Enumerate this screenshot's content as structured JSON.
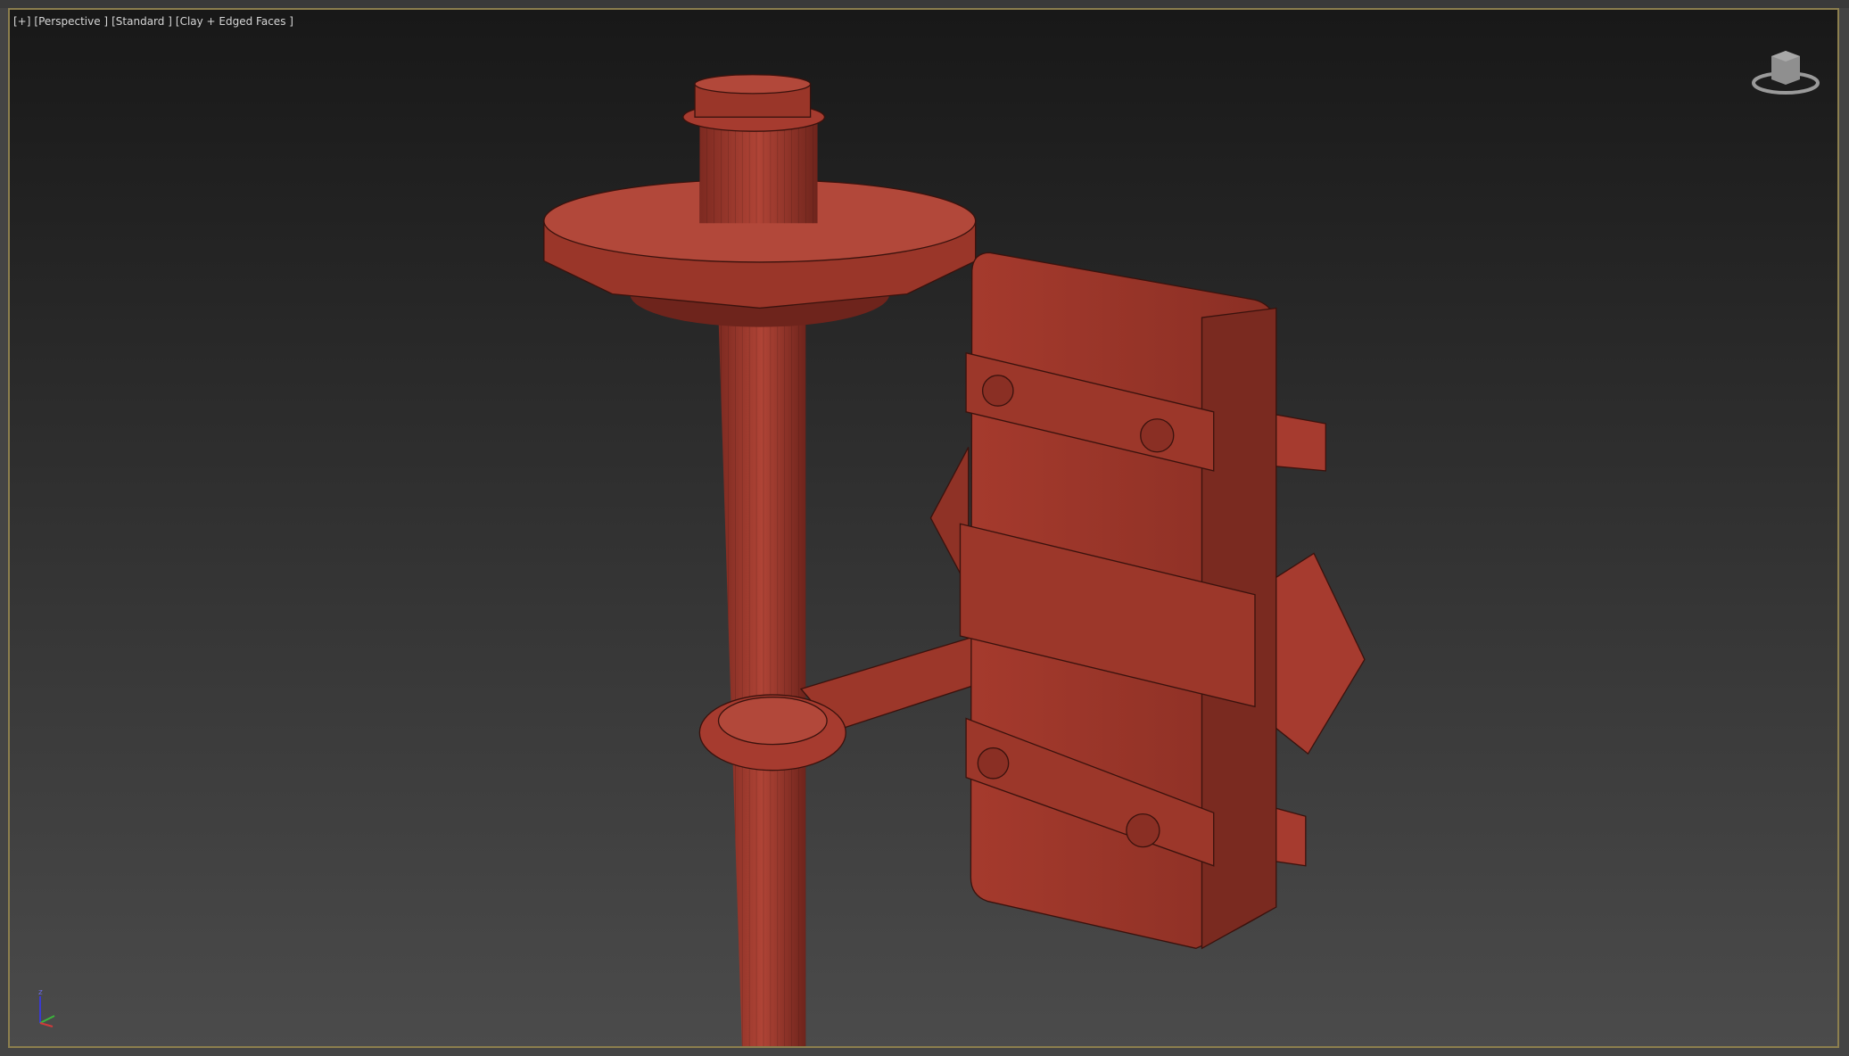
{
  "viewport": {
    "labels": [
      "[+]",
      "[Perspective ]",
      "[Standard ]",
      "[Clay + Edged Faces ]"
    ],
    "accent_border": "#8c7f4e",
    "model_color": "#a63b2f"
  },
  "gizmo": {
    "z_label": "z"
  },
  "icons": [
    "viewcube-icon",
    "axis-tripod-icon"
  ]
}
